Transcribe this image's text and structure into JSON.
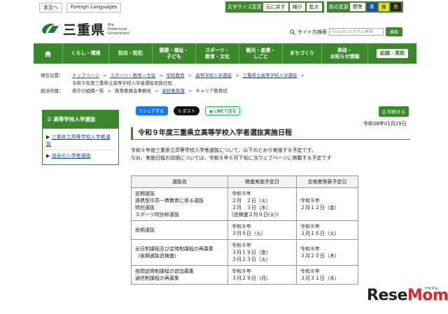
{
  "toplinks": {
    "main_text": "本文へ",
    "foreign": "Foreign Languages"
  },
  "textsize": {
    "label": "文字サイズ変更",
    "reset": "元に戻す",
    "small": "縮小",
    "large": "拡大"
  },
  "colorset": {
    "label": "色の変更",
    "standard": "標準",
    "blue": "青",
    "yellow": "黄",
    "black": "黒"
  },
  "logo": {
    "name": "三重県",
    "en1": "Mie",
    "en2": "Prefectural",
    "en3": "Government"
  },
  "search": {
    "label": "サイト内検索",
    "placeholder": "Google カスタム検索",
    "button": "検索"
  },
  "nav": {
    "items": [
      {
        "l1": "くらし・環境",
        "l2": ""
      },
      {
        "l1": "防災・防犯",
        "l2": ""
      },
      {
        "l1": "健康・福祉・",
        "l2": "子ども"
      },
      {
        "l1": "スポーツ・",
        "l2": "教育・文化"
      },
      {
        "l1": "観光・産業・",
        "l2": "しごと"
      },
      {
        "l1": "まちづくり",
        "l2": ""
      },
      {
        "l1": "県政・",
        "l2": "お知らせ情報"
      }
    ],
    "last": "組織・業務"
  },
  "breadcrumb": {
    "current_label": "現在位置：",
    "items": [
      "トップページ",
      "スポーツ・教育・文化",
      "学校教育",
      "高等学校入学選抜",
      "三重県立高等学校入学選抜"
    ],
    "current": "令和９年度三重県立高等学校入学者選抜実施日程",
    "dept_label": "担当所属：",
    "dept_items": [
      "県庁の組織一覧",
      "教育委員会事務局",
      "高校教育課",
      "キャリア教育班"
    ]
  },
  "sidebar": {
    "heading": "高等学校入学選抜",
    "links": [
      "三重県立高等学校入学者選抜",
      "過去の入学者選抜"
    ]
  },
  "social": {
    "facebook": "シェアする",
    "x": "ポスト",
    "line": "LINEで送る"
  },
  "print": "印刷する",
  "date": "令和08年01月29日",
  "title": "令和９年度三重県立高等学校入学者選抜実施日程",
  "body": {
    "p1": "令和９年度三重県立高等学校入学者選抜について、以下のとおり実施する予定です。",
    "p2": "なお、実施日程の詳細については、令和８年６月下旬に当ウェブページに掲載する予定です"
  },
  "table": {
    "headers": [
      "選抜名",
      "検査実施予定日",
      "合格者発表予定日"
    ],
    "rows": [
      {
        "name": [
          "前期選抜",
          "連携型中高一貫教育に係る選抜",
          "特別選抜",
          "スポーツ特別枠選抜"
        ],
        "exam": [
          "令和９年",
          "２月　２日（火）",
          "２月　３日（水）",
          "(追検査２月９日(火))"
        ],
        "result": [
          "令和９年",
          "２月１２日（金）"
        ]
      },
      {
        "name": [
          "後期選抜"
        ],
        "exam": [
          "令和９年",
          "３月９日（火）"
        ],
        "result": [
          "令和９年",
          "３月１６日（火）"
        ]
      },
      {
        "name": [
          "全日制課程及び定時制課程の再募集",
          "（後期選抜追検査）"
        ],
        "exam": [
          "令和９年",
          "３月１９日（金）",
          "３月２３日（火）"
        ],
        "result": [
          "令和９年",
          "３月２５日（木）"
        ]
      },
      {
        "name": [
          "夜間定時制課程の追加募集",
          "通信制課程の再募集"
        ],
        "exam": [
          "令和９年",
          "３月２９日（月）"
        ],
        "result": [
          "令和９年",
          "３月３１日（水）"
        ]
      }
    ]
  },
  "watermark": {
    "part1": "Rese",
    "part2": "Mom",
    "small": "リセマム"
  },
  "colors": {
    "brand_green": "#3a8a2c",
    "link_blue": "#1a4fa0"
  }
}
